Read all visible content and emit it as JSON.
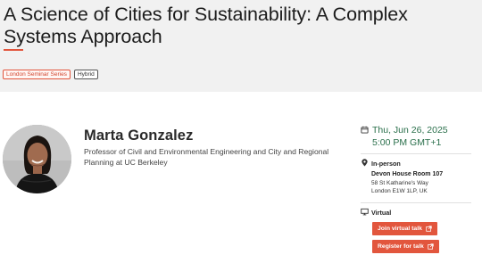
{
  "event": {
    "title": "A Science of Cities for Sustainability: A Complex Systems Approach",
    "tags": [
      "London Seminar Series",
      "Hybrid"
    ]
  },
  "speaker": {
    "name": "Marta Gonzalez",
    "bio": "Professor of Civil and Environmental Engineering and City and Regional Planning at UC Berkeley"
  },
  "schedule": {
    "date": "Thu, Jun 26, 2025",
    "time": "5:00 PM GMT+1"
  },
  "in_person": {
    "label": "In-person",
    "venue": "Devon House Room 107",
    "address_line1": "58 St Katharine's Way",
    "address_line2": "London E1W 1LP, UK"
  },
  "virtual": {
    "label": "Virtual",
    "join_label": "Join virtual talk",
    "register_label": "Register for talk"
  },
  "colors": {
    "accent": "#e2563d",
    "date_green": "#2a6f4b",
    "hero_bg": "#f1f1f1"
  },
  "icons": [
    "calendar-icon",
    "location-pin-icon",
    "monitor-icon",
    "external-link-icon"
  ]
}
